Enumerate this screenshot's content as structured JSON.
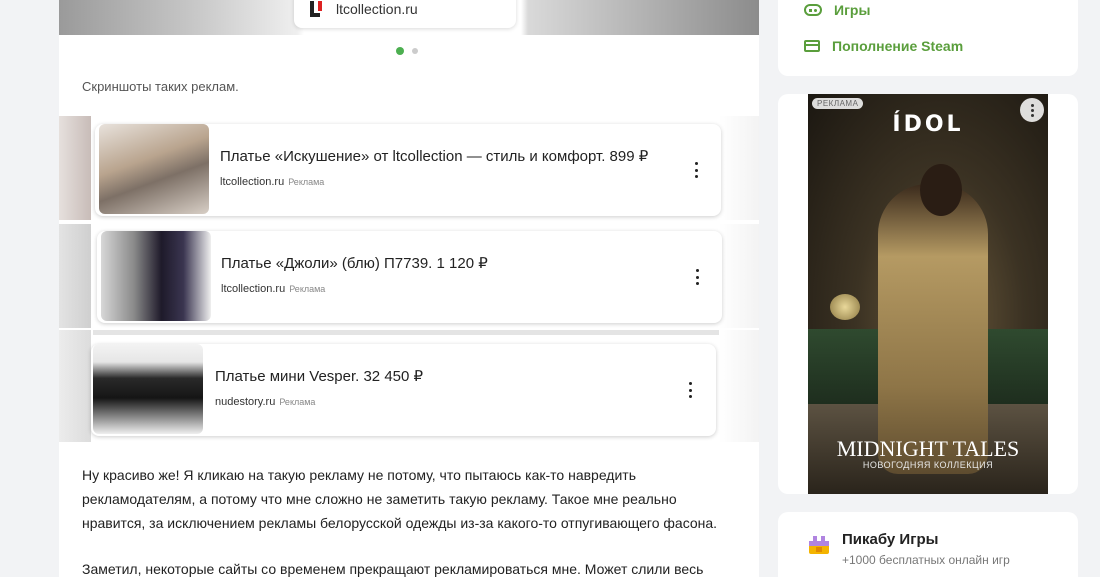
{
  "top_ad": {
    "domain": "ltcollection.ru"
  },
  "caption": "Скриншоты таких реклам.",
  "ads": [
    {
      "title": "Платье «Искушение» от ltcollection — стиль и комфорт. 899 ₽",
      "domain": "ltcollection.ru",
      "badge": "Реклама"
    },
    {
      "title": "Платье «Джоли» (блю) П7739. 1 120 ₽",
      "domain": "ltcollection.ru",
      "badge": "Реклама"
    },
    {
      "title": "Платье мини Vesper. 32 450 ₽",
      "domain": "nudestory.ru",
      "badge": "Реклама"
    }
  ],
  "paragraphs": [
    "Ну красиво же! Я кликаю на такую рекламу не потому, что пытаюсь как-то навредить рекламодателям, а потому что мне сложно не заметить такую рекламу. Такое мне реально нравится, за исключением рекламы белорусской одежды из-за какого-то отпугивающего фасона.",
    "Заметил, некоторые сайты со временем прекращают рекламироваться мне. Может слили весь"
  ],
  "sidebar": {
    "links": [
      {
        "label": "Игры",
        "icon": "gamepad-icon"
      },
      {
        "label": "Пополнение Steam",
        "icon": "card-icon"
      }
    ],
    "banner": {
      "tag": "РЕКЛАМА",
      "brand": "ÍDOL",
      "headline": "MIDNIGHT TALES",
      "subline": "НОВОГОДНЯЯ КОЛЛЕКЦИЯ"
    },
    "games": {
      "title": "Пикабу Игры",
      "subtitle": "+1000 бесплатных онлайн игр"
    }
  },
  "colors": {
    "accent": "#5a9e3c",
    "dot_active": "#4caf50"
  }
}
